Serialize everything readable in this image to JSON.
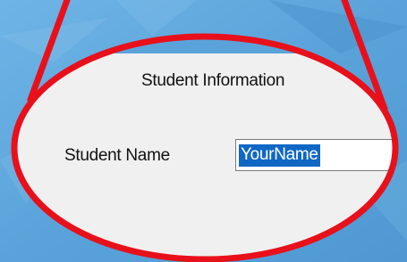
{
  "form": {
    "section_title": "Student Information",
    "student_name_label": "Student Name",
    "student_name_value": "YourName"
  },
  "colors": {
    "background_blue": "#5aa4dc",
    "panel_gray": "#f0f0f0",
    "highlight_red": "#e8101a",
    "selection_blue": "#1068c4"
  }
}
